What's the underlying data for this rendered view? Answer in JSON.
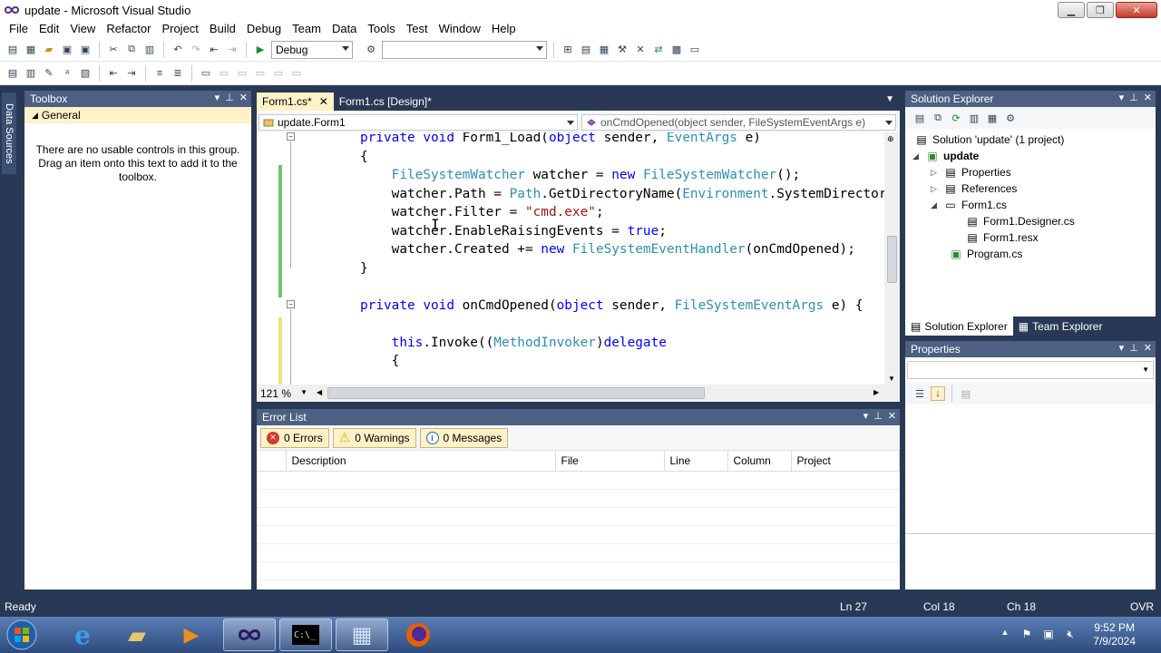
{
  "window": {
    "title": "update - Microsoft Visual Studio"
  },
  "menu": [
    "File",
    "Edit",
    "View",
    "Refactor",
    "Project",
    "Build",
    "Debug",
    "Team",
    "Data",
    "Tools",
    "Test",
    "Window",
    "Help"
  ],
  "toolbar": {
    "config_value": "Debug",
    "platform_value": ""
  },
  "side_strip": {
    "label": "Data Sources"
  },
  "toolbox": {
    "title": "Toolbox",
    "section": "General",
    "empty_message": "There are no usable controls in this group. Drag an item onto this text to add it to the toolbox."
  },
  "editor": {
    "tabs": [
      {
        "label": "Form1.cs*",
        "active": true
      },
      {
        "label": "Form1.cs [Design]*",
        "active": false
      }
    ],
    "nav_left": "update.Form1",
    "nav_right": "onCmdOpened(object sender, FileSystemEventArgs e)",
    "zoom": "121 %",
    "code": [
      [
        [
          "kw",
          "private"
        ],
        [
          "p",
          " "
        ],
        [
          "kw",
          "void"
        ],
        [
          "p",
          " Form1_Load("
        ],
        [
          "kw",
          "object"
        ],
        [
          "p",
          " sender, "
        ],
        [
          "ty",
          "EventArgs"
        ],
        [
          "p",
          " e)"
        ]
      ],
      [
        [
          "p",
          "{"
        ]
      ],
      [
        [
          "p",
          "    "
        ],
        [
          "ty",
          "FileSystemWatcher"
        ],
        [
          "p",
          " watcher = "
        ],
        [
          "kw",
          "new"
        ],
        [
          "p",
          " "
        ],
        [
          "ty",
          "FileSystemWatcher"
        ],
        [
          "p",
          "();"
        ]
      ],
      [
        [
          "p",
          "    watcher.Path = "
        ],
        [
          "ty",
          "Path"
        ],
        [
          "p",
          ".GetDirectoryName("
        ],
        [
          "ty",
          "Environment"
        ],
        [
          "p",
          ".SystemDirector"
        ]
      ],
      [
        [
          "p",
          "    watcher.Filter = "
        ],
        [
          "str",
          "\"cmd.exe\""
        ],
        [
          "p",
          ";"
        ]
      ],
      [
        [
          "p",
          "    watcher.EnableRaisingEvents = "
        ],
        [
          "kw",
          "true"
        ],
        [
          "p",
          ";"
        ]
      ],
      [
        [
          "p",
          "    watcher.Created += "
        ],
        [
          "kw",
          "new"
        ],
        [
          "p",
          " "
        ],
        [
          "ty",
          "FileSystemEventHandler"
        ],
        [
          "p",
          "(onCmdOpened);"
        ]
      ],
      [
        [
          "p",
          "}"
        ]
      ],
      [
        [
          "p",
          ""
        ]
      ],
      [
        [
          "kw",
          "private"
        ],
        [
          "p",
          " "
        ],
        [
          "kw",
          "void"
        ],
        [
          "p",
          " onCmdOpened("
        ],
        [
          "kw",
          "object"
        ],
        [
          "p",
          " sender, "
        ],
        [
          "ty",
          "FileSystemEventArgs"
        ],
        [
          "p",
          " e) {"
        ]
      ],
      [
        [
          "p",
          ""
        ]
      ],
      [
        [
          "p",
          "    "
        ],
        [
          "kw",
          "this"
        ],
        [
          "p",
          ".Invoke(("
        ],
        [
          "ty",
          "MethodInvoker"
        ],
        [
          "p",
          ")"
        ],
        [
          "kw",
          "delegate"
        ]
      ],
      [
        [
          "p",
          "    {"
        ]
      ]
    ]
  },
  "error_list": {
    "title": "Error List",
    "errors": "0 Errors",
    "warnings": "0 Warnings",
    "messages": "0 Messages",
    "columns": [
      "",
      "Description",
      "File",
      "Line",
      "Column",
      "Project"
    ]
  },
  "solution_explorer": {
    "title": "Solution Explorer",
    "items": [
      {
        "label": "Solution 'update' (1 project)"
      },
      {
        "label": "update"
      },
      {
        "label": "Properties"
      },
      {
        "label": "References"
      },
      {
        "label": "Form1.cs"
      },
      {
        "label": "Form1.Designer.cs"
      },
      {
        "label": "Form1.resx"
      },
      {
        "label": "Program.cs"
      }
    ],
    "tabs": [
      "Solution Explorer",
      "Team Explorer"
    ]
  },
  "properties": {
    "title": "Properties"
  },
  "status": {
    "text": "Ready",
    "ln": "Ln 27",
    "col": "Col 18",
    "ch": "Ch 18",
    "mode": "OVR"
  },
  "taskbar": {
    "time": "9:52 PM",
    "date": "7/9/2024"
  }
}
